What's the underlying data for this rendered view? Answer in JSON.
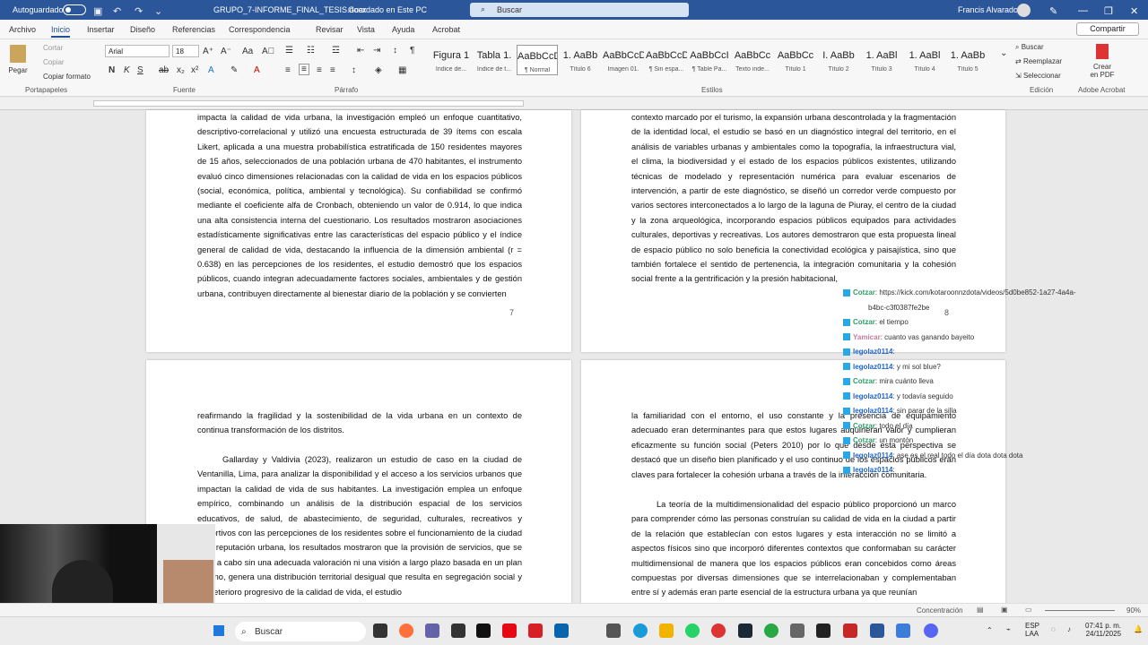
{
  "titlebar": {
    "autosave": "Autoguardado",
    "document": "GRUPO_7-INFORME_FINAL_TESIS.docx",
    "saved": "Guardado en Este PC",
    "search": "Buscar",
    "user": "Francis Alvarado"
  },
  "tabs": [
    "Archivo",
    "Inicio",
    "Insertar",
    "Diseño",
    "Referencias",
    "Correspondencia",
    "Revisar",
    "Vista",
    "Ayuda",
    "Acrobat"
  ],
  "share": "Compartir",
  "ribbon": {
    "paste": "Pegar",
    "cut": "Cortar",
    "copy": "Copiar",
    "copy_format": "Copiar formato",
    "clipboard": "Portapapeles",
    "font": "Arial",
    "size": "18",
    "font_group": "Fuente",
    "paragraph_group": "Párrafo",
    "styles_group": "Estilos",
    "edit_group": "Edición",
    "adobe_group": "Adobe Acrobat",
    "search": "Buscar",
    "replace": "Reemplazar",
    "select": "Seleccionar",
    "create_pdf": "Crear en PDF"
  },
  "styles": [
    {
      "big": "Figura 1",
      "small": "Indice de..."
    },
    {
      "big": "Tabla 1.",
      "small": "Índice de t..."
    },
    {
      "big": "AaBbCcDc",
      "small": "¶ Normal"
    },
    {
      "big": "1. AaBb",
      "small": "Título 6"
    },
    {
      "big": "AaBbCcDc",
      "small": "Imagen 01."
    },
    {
      "big": "AaBbCcDc",
      "small": "¶ Sin espa..."
    },
    {
      "big": "AaBbCcI",
      "small": "¶ Table Pa..."
    },
    {
      "big": "AaBbCc",
      "small": "Texto inde..."
    },
    {
      "big": "AaBbCc",
      "small": "Título 1"
    },
    {
      "big": "I. AaBb",
      "small": "Título 2"
    },
    {
      "big": "1. AaBl",
      "small": "Título 3"
    },
    {
      "big": "1. AaBl",
      "small": "Título 4"
    },
    {
      "big": "1. AaBb",
      "small": "Título 5"
    }
  ],
  "pages": {
    "p1": "impacta la calidad de vida urbana, la investigación empleó un enfoque cuantitativo, descriptivo-correlacional y utilizó una encuesta estructurada de 39 ítems con escala Likert, aplicada a una muestra probabilística estratificada de 150 residentes mayores de 15 años, seleccionados de una población urbana de 470 habitantes, el instrumento evaluó cinco dimensiones relacionadas con la calidad de vida en los espacios públicos (social, económica, política, ambiental y tecnológica). Su confiabilidad se confirmó mediante el coeficiente alfa de Cronbach, obteniendo un valor de 0.914, lo que indica una alta consistencia interna del cuestionario. Los resultados mostraron asociaciones estadísticamente significativas entre las características del espacio público y el índice general de calidad de vida, destacando la influencia de la dimensión ambiental (r = 0.638) en las percepciones de los residentes, el estudio demostró que los espacios públicos, cuando integran adecuadamente factores sociales, ambientales y de gestión urbana, contribuyen directamente al bienestar diario de la población y se convierten",
    "p1num": "7",
    "p2": "contexto marcado por el turismo, la expansión urbana descontrolada y la fragmentación de la identidad local, el estudio se basó en un diagnóstico integral del territorio, en el análisis de variables urbanas y ambientales como la topografía, la infraestructura vial, el clima, la biodiversidad y el estado de los espacios públicos existentes, utilizando técnicas de modelado y representación numérica para evaluar escenarios de intervención, a partir de este diagnóstico, se diseñó un corredor verde compuesto por varios sectores interconectados a lo largo de la laguna de Piuray, el centro de la ciudad y la zona arqueológica, incorporando espacios públicos equipados para actividades culturales, deportivas y recreativas. Los autores demostraron que esta propuesta lineal de espacio público no solo beneficia la conectividad ecológica y paisajística, sino que también fortalece el sentido de pertenencia, la integración comunitaria y la cohesión social frente a la gentrificación y la presión habitacional,",
    "p2num": "8",
    "p3a": "reafirmando la fragilidad y la sostenibilidad de la vida urbana en un contexto de continua transformación de los distritos.",
    "p3b": "Gallarday y Valdivia (2023), realizaron un estudio de caso en la ciudad de Ventanilla, Lima, para analizar la disponibilidad y el acceso a los servicios urbanos que impactan la calidad de vida de sus habitantes. La investigación emplea un enfoque empírico, combinando un análisis de la distribución espacial de los servicios educativos, de salud, de abastecimiento, de seguridad, culturales, recreativos y deportivos con las percepciones de los residentes sobre el funcionamiento de la ciudad y su reputación urbana, los resultados mostraron que la provisión de servicios, que se lleva a cabo sin una adecuada valoración ni una visión a largo plazo basada en un plan urbano, genera una distribución territorial desigual que resulta en segregación social y un deterioro progresivo de la calidad de vida, el estudio",
    "p4a": "la familiaridad con el entorno, el uso constante y la presencia de equipamiento adecuado eran determinantes para que estos lugares adquirieran valor y cumplieran eficazmente su función social (Peters 2010) por lo que desde esta perspectiva se destacó que un diseño bien planificado y el uso continuo de los espacios públicos eran claves para fortalecer la cohesión urbana a través de la interacción comunitaria.",
    "p4b": "La teoría de la multidimensionalidad del espacio público proporcionó un marco para comprender cómo las personas construían su calidad de vida en la ciudad a partir de la relación que establecían con estos lugares y esta interacción no se limitó a aspectos físicos sino que incorporó diferentes contextos que conformaban su carácter multidimensional de manera que los espacios públicos eran concebidos como áreas compuestas por diversas dimensiones que se interrelacionaban y complementaban entre sí y además eran parte esencial de la estructura urbana ya que reunían"
  },
  "chat": [
    {
      "user": "Cotzar",
      "msg": ": https://kick.com/kotaroonnzdota/videos/5d0be852-1a27-4a4a-",
      "color": "#2e9e69"
    },
    {
      "user": "",
      "msg": "b4bc-c3f0387fe2be",
      "color": "#2e9e69"
    },
    {
      "user": "Cotzar",
      "msg": ": el tiempo",
      "color": "#2e9e69"
    },
    {
      "user": "Yamicar",
      "msg": ": cuanto vas ganando bayeito",
      "color": "#c57aa0"
    },
    {
      "user": "legolaz0114",
      "msg": ":",
      "color": "#1d63c9"
    },
    {
      "user": "legolaz0114",
      "msg": ": y mi sol blue?",
      "color": "#1d63c9"
    },
    {
      "user": "Cotzar",
      "msg": ": mira cuánto lleva",
      "color": "#2e9e69"
    },
    {
      "user": "legolaz0114",
      "msg": ": y todavía seguido",
      "color": "#1d63c9"
    },
    {
      "user": "legolaz0114",
      "msg": ": sin parar de la silla",
      "color": "#1d63c9"
    },
    {
      "user": "Cotzar",
      "msg": ": todo el día",
      "color": "#2e9e69"
    },
    {
      "user": "Cotzar",
      "msg": ": un montón",
      "color": "#2e9e69"
    },
    {
      "user": "legolaz0114",
      "msg": ": ase es el real todo el día dota dota dota",
      "color": "#1d63c9"
    },
    {
      "user": "legolaz0114",
      "msg": ":",
      "color": "#1d63c9"
    }
  ],
  "status": {
    "focus": "Concentración",
    "zoom": "90%"
  },
  "taskbar": {
    "search": "Buscar",
    "lang": "ESP",
    "region": "LAA",
    "time": "07:41 p. m.",
    "date": "24/11/2025"
  }
}
